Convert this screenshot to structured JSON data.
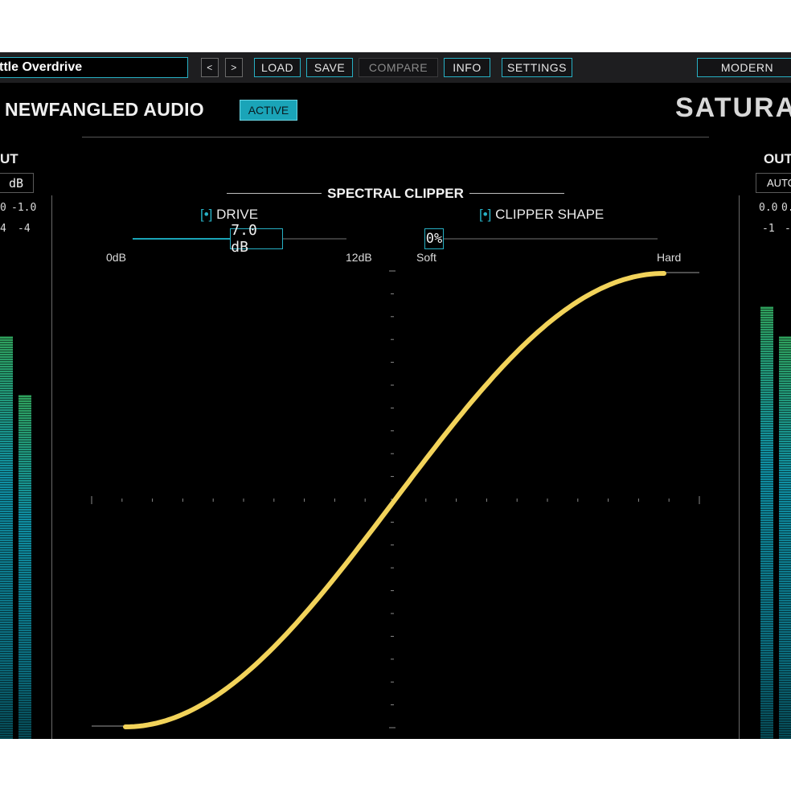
{
  "header": {
    "preset_name": "ttle Overdrive",
    "prev_label": "<",
    "next_label": ">",
    "buttons": {
      "load": "LOAD",
      "save": "SAVE",
      "compare": "COMPARE",
      "info": "INFO",
      "settings": "SETTINGS",
      "modern": "MODERN"
    }
  },
  "brand": {
    "name": "NEWFANGLED AUDIO",
    "active_label": "ACTIVE",
    "product_logo": "SATURAT"
  },
  "input_meter": {
    "label": "UT",
    "gain_value": "dB",
    "peak_left": "0",
    "peak_right": "-1.0",
    "rms_left": "4",
    "rms_right": "-4",
    "levels": [
      0.82,
      0.7
    ]
  },
  "output_meter": {
    "label": "OUT",
    "gain_value": "AUTO",
    "peak_left": "0.0",
    "peak_right": "0.",
    "rms_left": "-1",
    "rms_right": "-",
    "levels": [
      0.88,
      0.82
    ]
  },
  "spectral_clipper": {
    "title": "SPECTRAL CLIPPER",
    "drive": {
      "bracket": "[•]",
      "label": "DRIVE",
      "value": "7.0 dB",
      "value_fraction": 0.58,
      "min_label": "0dB",
      "max_label": "12dB"
    },
    "clipper_shape": {
      "bracket": "[•]",
      "label": "CLIPPER SHAPE",
      "value": "0%",
      "value_fraction": 0.0,
      "min_label": "Soft",
      "max_label": "Hard"
    }
  },
  "curve": {
    "color": "#f2d35a",
    "drive_db": 7.0
  },
  "colors": {
    "accent": "#1aa4b8",
    "curve": "#f2d35a",
    "meter_green": "#2fa15c",
    "meter_teal": "#0f8fa3"
  }
}
